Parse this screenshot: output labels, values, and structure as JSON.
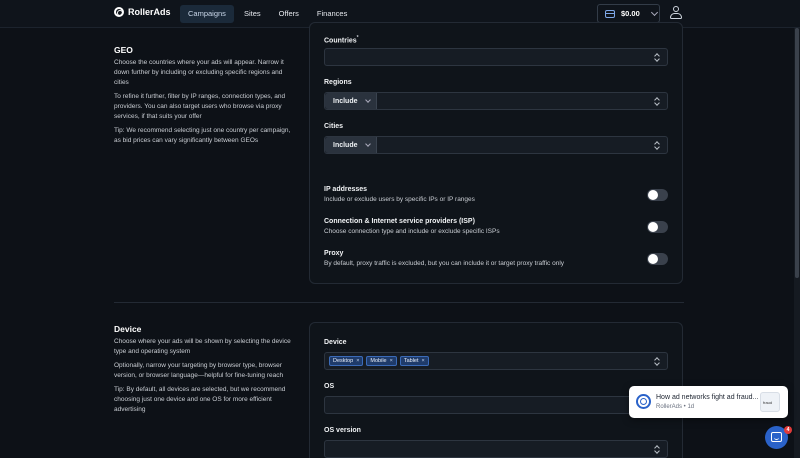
{
  "brand": {
    "name": "RollerAds"
  },
  "nav": [
    {
      "label": "Campaigns",
      "active": true
    },
    {
      "label": "Sites",
      "active": false
    },
    {
      "label": "Offers",
      "active": false
    },
    {
      "label": "Finances",
      "active": false
    }
  ],
  "balance": {
    "value": "$0.00"
  },
  "geo": {
    "title": "GEO",
    "paragraphs": [
      "Choose the countries where your ads will appear. Narrow it down further by including or excluding specific regions and cities",
      "To refine it further, filter by IP ranges, connection types, and providers. You can also target users who browse via proxy services, if that suits your offer",
      "Tip: We recommend selecting just one country per campaign, as bid prices can vary significantly between GEOs"
    ],
    "countries_label": "Countries",
    "countries_required": "*",
    "countries_value": "",
    "regions_label": "Regions",
    "regions_mode": "Include",
    "cities_label": "Cities",
    "cities_mode": "Include",
    "toggles": [
      {
        "title": "IP addresses",
        "desc": "Include or exclude users by specific IPs or IP ranges",
        "on": false
      },
      {
        "title": "Connection & Internet service providers (ISP)",
        "desc": "Choose connection type and include or exclude specific ISPs",
        "on": false
      },
      {
        "title": "Proxy",
        "desc": "By default, proxy traffic is excluded, but you can include it or target proxy traffic only",
        "on": false
      }
    ]
  },
  "device": {
    "title": "Device",
    "paragraphs": [
      "Choose where your ads will be shown by selecting the device type and operating system",
      "Optionally, narrow your targeting by browser type, browser version, or browser language—helpful for fine-tuning reach",
      "Tip: By default, all devices are selected, but we recommend choosing just one device and one OS for more efficient advertising"
    ],
    "device_label": "Device",
    "chips": [
      "Desktop",
      "Mobile",
      "Tablet"
    ],
    "os_label": "OS",
    "os_version_label": "OS version"
  },
  "notification": {
    "title": "How ad networks fight ad fraud...",
    "sub": "RollerAds • 1d",
    "thumb_text": "fraud"
  },
  "chat": {
    "badge": "4"
  },
  "colors": {
    "accent": "#2a62c9",
    "background": "#0d1117",
    "panel": "#0f141a"
  }
}
